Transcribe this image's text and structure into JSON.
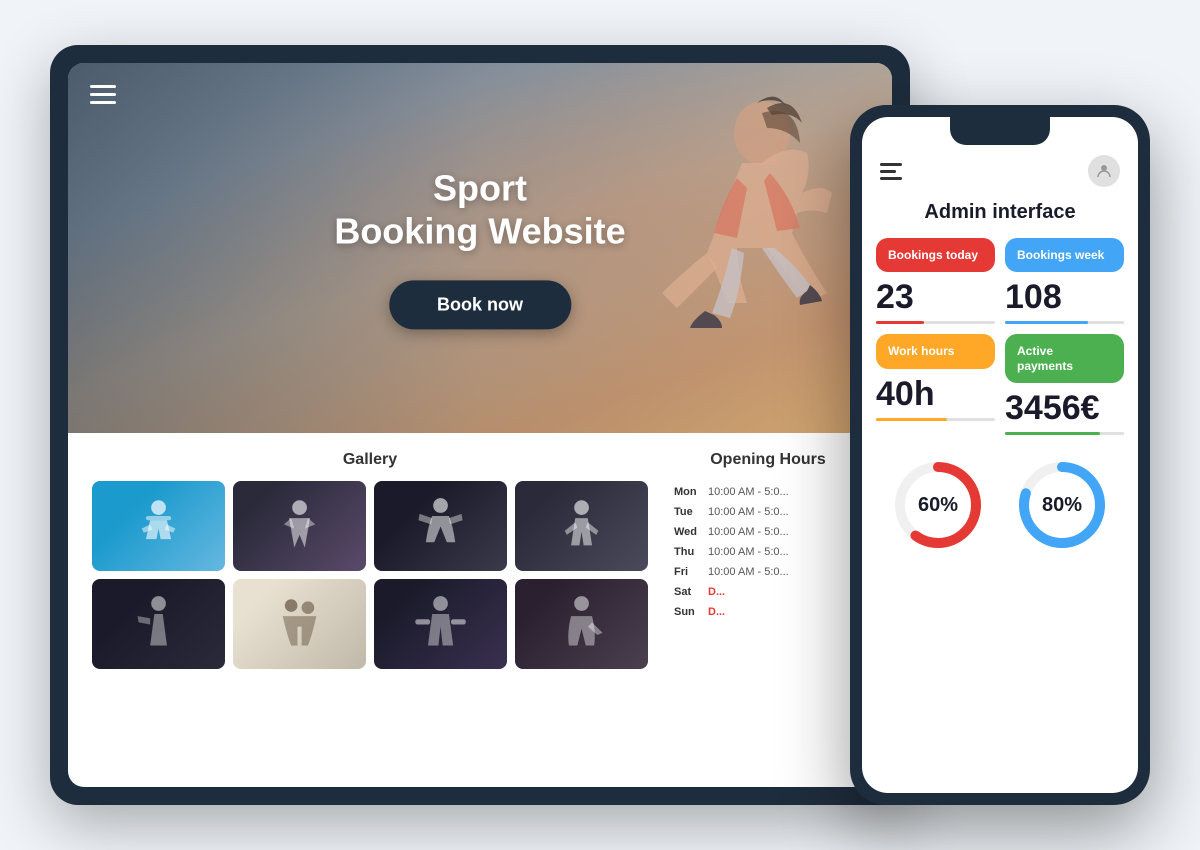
{
  "scene": {
    "tablet": {
      "hero": {
        "hamburger_label": "menu",
        "title_line1": "Sport",
        "title_line2": "Booking Website",
        "book_button": "Book now"
      },
      "gallery": {
        "title": "Gallery",
        "items": [
          {
            "id": 1,
            "class": "g1",
            "emoji": "🏋️"
          },
          {
            "id": 2,
            "class": "g2",
            "emoji": "💪"
          },
          {
            "id": 3,
            "class": "g3",
            "emoji": "🤸"
          },
          {
            "id": 4,
            "class": "g4",
            "emoji": "🏃"
          },
          {
            "id": 5,
            "class": "g5",
            "emoji": "🏋️"
          },
          {
            "id": 6,
            "class": "g6",
            "emoji": "🤼"
          },
          {
            "id": 7,
            "class": "g7",
            "emoji": "🏋️"
          },
          {
            "id": 8,
            "class": "g8",
            "emoji": "🤸"
          }
        ]
      },
      "opening_hours": {
        "title": "Opening Hours",
        "days": [
          {
            "day": "Mon",
            "hours": "10:00 AM - 5:0...",
            "closed": false
          },
          {
            "day": "Tue",
            "hours": "10:00 AM - 5:0...",
            "closed": false
          },
          {
            "day": "Wed",
            "hours": "10:00 AM - 5:0...",
            "closed": false
          },
          {
            "day": "Thu",
            "hours": "10:00 AM - 5:0...",
            "closed": false
          },
          {
            "day": "Fri",
            "hours": "10:00 AM - 5:0...",
            "closed": false
          },
          {
            "day": "Sat",
            "hours": "D...",
            "closed": true
          },
          {
            "day": "Sun",
            "hours": "D...",
            "closed": true
          }
        ]
      }
    },
    "phone": {
      "header": {
        "menu_label": "menu",
        "avatar_label": "user avatar"
      },
      "admin_title": "Admin interface",
      "stats": [
        {
          "id": "bookings-today",
          "label": "Bookings today",
          "value": "23",
          "color_class": "card-red",
          "bar_class": "bar-red"
        },
        {
          "id": "bookings-week",
          "label": "Bookings week",
          "value": "108",
          "color_class": "card-blue",
          "bar_class": "bar-blue"
        },
        {
          "id": "work-hours",
          "label": "Work hours",
          "value": "40h",
          "color_class": "card-yellow",
          "bar_class": "bar-yellow"
        },
        {
          "id": "active-payments",
          "label": "Active payments",
          "value": "3456€",
          "color_class": "card-green",
          "bar_class": "bar-green"
        }
      ],
      "charts": [
        {
          "id": "chart-red",
          "percent": 60,
          "label": "60%",
          "color": "#e53935",
          "track": "#f0f0f0"
        },
        {
          "id": "chart-blue",
          "percent": 80,
          "label": "80%",
          "color": "#42a5f5",
          "track": "#f0f0f0"
        }
      ]
    }
  }
}
